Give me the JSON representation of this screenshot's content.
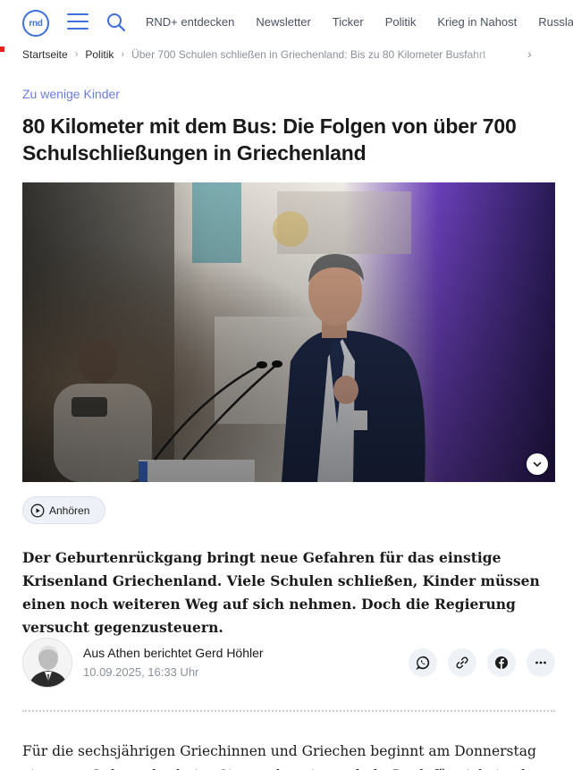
{
  "logo": {
    "text": "rnd"
  },
  "nav": {
    "items": [
      "RND+ entdecken",
      "Newsletter",
      "Ticker",
      "Politik",
      "Krieg in Nahost",
      "Russland"
    ]
  },
  "breadcrumb": {
    "home": "Startseite",
    "section": "Politik",
    "current": "Über 700 Schulen schließen in Griechenland: Bis zu 80 Kilometer Busfahrt"
  },
  "article": {
    "kicker": "Zu wenige Kinder",
    "headline": "80 Kilometer mit dem Bus: Die Folgen von über 700 Schulschließungen in Griechenland",
    "listen_label": "Anhören",
    "lead": "Der Geburtenrückgang bringt neue Gefahren für das einstige Krisenland Griechenland. Viele Schulen schließen, Kinder müssen einen noch weiteren Weg auf sich nehmen. Doch die Regierung versucht gegenzusteuern.",
    "author_line": "Aus Athen berichtet Gerd Höhler",
    "date": "10.09.2025, 16:33 Uhr",
    "body_start": "Für die sechsjährigen Griechinnen und Griechen beginnt am Donnerstag ein neuer Lebensabschnitt: Sie werden eingeschult. Doch für viele ist der"
  },
  "share": {
    "icons": [
      "whatsapp-icon",
      "link-icon",
      "facebook-icon",
      "more-icon"
    ]
  },
  "colors": {
    "accent": "#3f6fd8",
    "kicker": "#6b7de0",
    "brand_red": "#e2231a"
  }
}
